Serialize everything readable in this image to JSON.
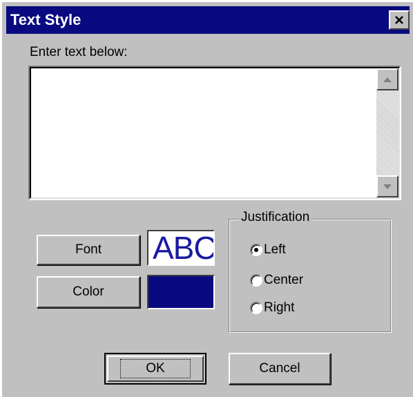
{
  "window": {
    "title": "Text Style",
    "close_label": "✕",
    "titlebar_color": "#0a0a80"
  },
  "text_entry": {
    "label": "Enter text below:",
    "value": "",
    "scroll_up_icon": "▲",
    "scroll_down_icon": "▼"
  },
  "font": {
    "button_label": "Font",
    "preview_text": "ABC",
    "preview_color": "#1a1aa0"
  },
  "color": {
    "button_label": "Color",
    "swatch": "#0a0a80"
  },
  "justification": {
    "label": "Justification",
    "options": [
      {
        "label": "Left",
        "checked": true
      },
      {
        "label": "Center",
        "checked": false
      },
      {
        "label": "Right",
        "checked": false
      }
    ]
  },
  "buttons": {
    "ok": "OK",
    "cancel": "Cancel"
  }
}
